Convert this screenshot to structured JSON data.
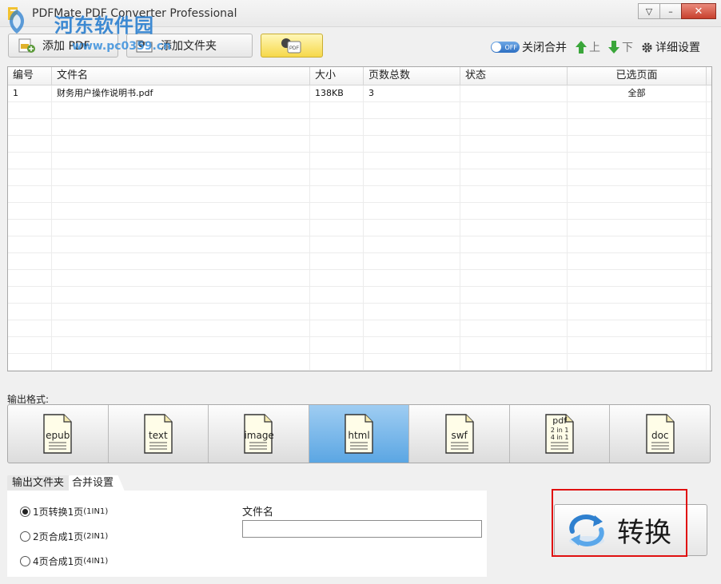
{
  "window": {
    "title": "PDFMate PDF Converter Professional",
    "minimize_glyph": "▽",
    "restore_glyph": "–",
    "close_glyph": "✕"
  },
  "watermark": {
    "title": "河东软件园",
    "url": "www.pc0359.cn"
  },
  "toolbar": {
    "add_pdf": "添加 PDF",
    "add_folder": "添加文件夹",
    "pdf_badge": "PDF",
    "merge_toggle_state": "OFF",
    "merge_label": "关闭合并",
    "up_label": "上",
    "down_label": "下",
    "settings_label": "详细设置"
  },
  "table": {
    "columns": [
      "编号",
      "文件名",
      "大小",
      "页数总数",
      "状态",
      "已选页面"
    ],
    "rows": [
      [
        "1",
        "财务用户操作说明书.pdf",
        "138KB",
        "3",
        "",
        "全部"
      ]
    ],
    "empty_rows": 16
  },
  "output": {
    "label": "输出格式:",
    "formats": [
      {
        "name": "epub",
        "label": "epub"
      },
      {
        "name": "text",
        "label": "text"
      },
      {
        "name": "image",
        "label": "image"
      },
      {
        "name": "html",
        "label": "html",
        "active": true
      },
      {
        "name": "swf",
        "label": "swf"
      },
      {
        "name": "pdf-nup",
        "label": "pdf",
        "sub": [
          "2 in 1",
          "4 in 1"
        ]
      },
      {
        "name": "doc",
        "label": "doc"
      }
    ]
  },
  "tabs": [
    {
      "label": "输出文件夹",
      "active": false
    },
    {
      "label": "合并设置",
      "active": true
    }
  ],
  "merge_settings": {
    "options": [
      {
        "main": "1页转换1页",
        "sub": "(1IN1)",
        "checked": true
      },
      {
        "main": "2页合成1页",
        "sub": "(2IN1)",
        "checked": false
      },
      {
        "main": "4页合成1页",
        "sub": "(4IN1)",
        "checked": false
      }
    ],
    "filename_label": "文件名",
    "filename_value": ""
  },
  "convert": {
    "label": "转换"
  },
  "colors": {
    "active_format": "#5ba6e3",
    "highlight_box": "#e01010",
    "pdf_button": "#f6d84a"
  }
}
